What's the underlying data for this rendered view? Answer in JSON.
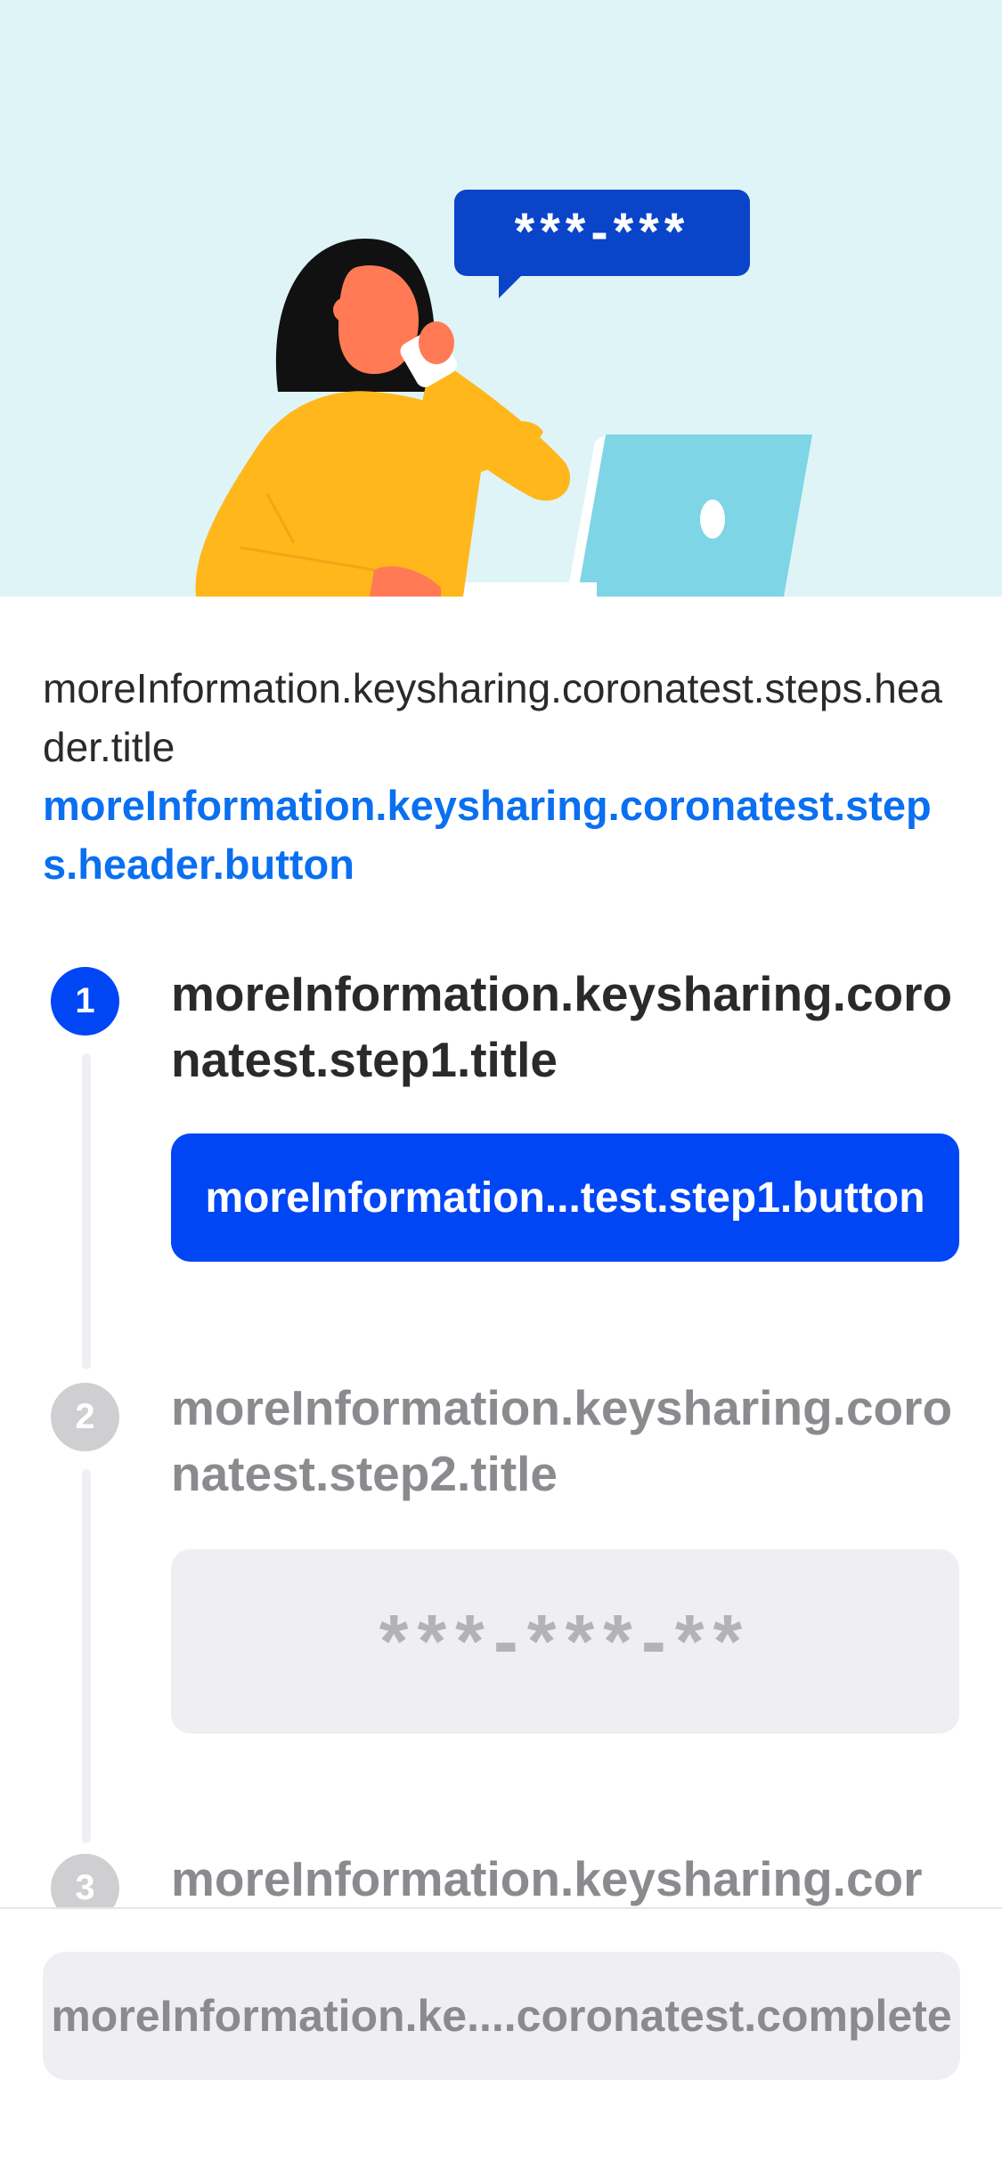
{
  "hero": {
    "speech_bubble_text": "***-***",
    "illustration_icon": "person-on-phone-illustration"
  },
  "header": {
    "title": "moreInformation.keysharing.coronatest.steps.header.title",
    "button": "moreInformation.keysharing.coronatest.steps.header.button"
  },
  "steps": [
    {
      "number": "1",
      "title": "moreInformation.keysharing.coronatest.step1.title",
      "button": "moreInformation...test.step1.button",
      "state": "active"
    },
    {
      "number": "2",
      "title": "moreInformation.keysharing.coronatest.step2.title",
      "code_placeholder": "***-***-**",
      "state": "inactive"
    },
    {
      "number": "3",
      "title": "moreInformation.keysharing.cor",
      "state": "inactive"
    }
  ],
  "footer": {
    "complete_button": "moreInformation.ke....coronatest.complete"
  },
  "colors": {
    "accent": "#0046f5",
    "link": "#0a6ff0",
    "hero_bg": "#dff4f7",
    "inactive": "#cfcfd2"
  }
}
